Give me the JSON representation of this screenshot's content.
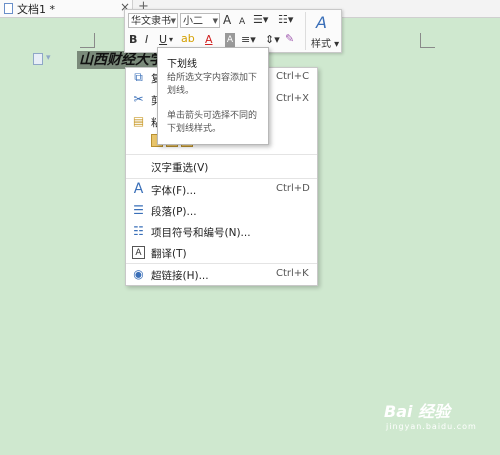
{
  "tabs": {
    "doc_title": "文档1 *",
    "close_glyph": "×",
    "new_tab_glyph": "+"
  },
  "document": {
    "selected_text": "山西财经大学"
  },
  "mini_toolbar": {
    "font_name": "华文隶书",
    "font_size": "小二",
    "grow_font": "A",
    "shrink_font": "A",
    "bold": "B",
    "italic": "I",
    "underline": "U",
    "font_color": "A",
    "char_shading": "A",
    "styles_label": "样式"
  },
  "tooltip": {
    "title": "下划线",
    "desc1": "给所选文字内容添加下划线。",
    "desc2": "单击箭头可选择不同的下划线样式。"
  },
  "context_menu": {
    "copy_label": "复",
    "copy_shortcut": "Ctrl+C",
    "cut_label": "剪",
    "cut_shortcut": "Ctrl+X",
    "paste_label": "粘",
    "reselect_label": "汉字重选(V)",
    "font_label": "字体(F)...",
    "font_shortcut": "Ctrl+D",
    "paragraph_label": "段落(P)...",
    "bullets_label": "项目符号和编号(N)...",
    "translate_label": "翻译(T)",
    "hyperlink_label": "超链接(H)...",
    "hyperlink_shortcut": "Ctrl+K"
  },
  "watermark": {
    "main": "Bai 经验",
    "sub": "jingyan.baidu.com"
  },
  "colors": {
    "page_bg": "#cfe8cf",
    "accent": "#3a6fb8",
    "font_color_red": "#d02020",
    "highlight_yellow": "#f2d21b"
  },
  "icons": [
    "doc-icon",
    "copy-icon",
    "cut-icon",
    "paste-icon",
    "font-icon",
    "paragraph-icon",
    "bullets-icon",
    "translate-icon",
    "hyperlink-icon",
    "styles-icon"
  ]
}
